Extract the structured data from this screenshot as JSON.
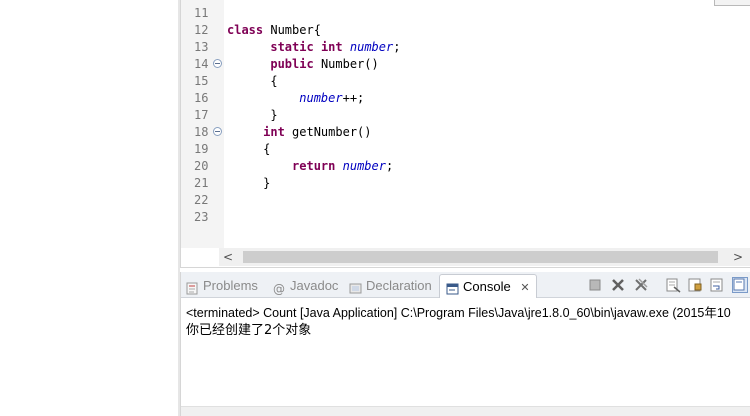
{
  "editor": {
    "lines": [
      {
        "num": "11",
        "fold": false,
        "parts": []
      },
      {
        "num": "12",
        "fold": false,
        "parts": [
          {
            "t": "class",
            "c": "kw"
          },
          {
            "t": " Number{",
            "c": ""
          }
        ]
      },
      {
        "num": "13",
        "fold": false,
        "parts": [
          {
            "t": "      ",
            "c": ""
          },
          {
            "t": "static",
            "c": "kw"
          },
          {
            "t": " ",
            "c": ""
          },
          {
            "t": "int",
            "c": "kw"
          },
          {
            "t": " ",
            "c": ""
          },
          {
            "t": "number",
            "c": "fld"
          },
          {
            "t": ";",
            "c": ""
          }
        ]
      },
      {
        "num": "14",
        "fold": true,
        "parts": [
          {
            "t": "      ",
            "c": ""
          },
          {
            "t": "public",
            "c": "kw"
          },
          {
            "t": " Number()",
            "c": ""
          }
        ]
      },
      {
        "num": "15",
        "fold": false,
        "parts": [
          {
            "t": "      {",
            "c": ""
          }
        ]
      },
      {
        "num": "16",
        "fold": false,
        "parts": [
          {
            "t": "          ",
            "c": ""
          },
          {
            "t": "number",
            "c": "fld"
          },
          {
            "t": "++;",
            "c": ""
          }
        ]
      },
      {
        "num": "17",
        "fold": false,
        "parts": [
          {
            "t": "      }",
            "c": ""
          }
        ]
      },
      {
        "num": "18",
        "fold": true,
        "parts": [
          {
            "t": "     ",
            "c": ""
          },
          {
            "t": "int",
            "c": "kw"
          },
          {
            "t": " getNumber()",
            "c": ""
          }
        ]
      },
      {
        "num": "19",
        "fold": false,
        "parts": [
          {
            "t": "     {",
            "c": ""
          }
        ]
      },
      {
        "num": "20",
        "fold": false,
        "parts": [
          {
            "t": "         ",
            "c": ""
          },
          {
            "t": "return",
            "c": "kw"
          },
          {
            "t": " ",
            "c": ""
          },
          {
            "t": "number",
            "c": "fld"
          },
          {
            "t": ";",
            "c": ""
          }
        ]
      },
      {
        "num": "21",
        "fold": false,
        "parts": [
          {
            "t": "     }",
            "c": ""
          }
        ]
      },
      {
        "num": "22",
        "fold": false,
        "parts": []
      },
      {
        "num": "23",
        "fold": false,
        "parts": []
      }
    ],
    "scroll_left": "<",
    "scroll_right": ">"
  },
  "tabs": {
    "problems": "Problems",
    "javadoc": "Javadoc",
    "declaration": "Declaration",
    "console": "Console",
    "close": "✕"
  },
  "console": {
    "header": "<terminated> Count [Java Application] C:\\Program Files\\Java\\jre1.8.0_60\\bin\\javaw.exe (2015年10",
    "output": "你已经创建了2个对象"
  },
  "colors": {
    "keyword": "#7f0055",
    "field": "#0000c0",
    "line_number": "#787878"
  }
}
